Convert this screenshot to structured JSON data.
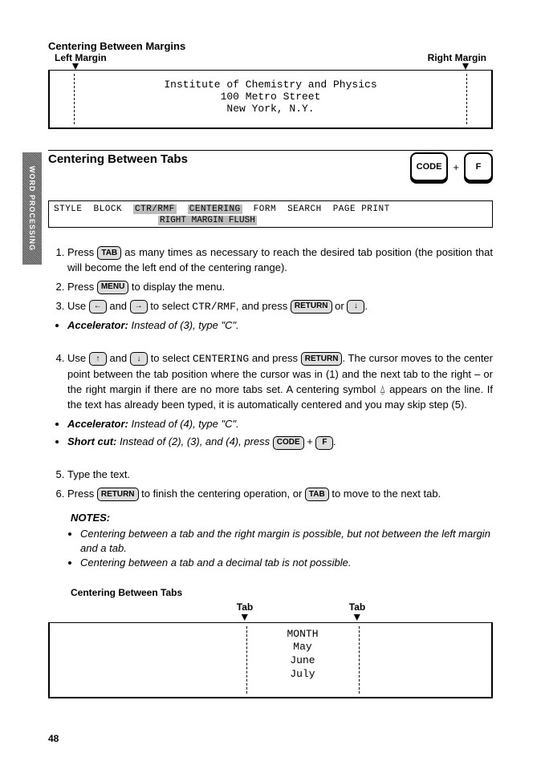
{
  "sidebar": {
    "label": "WORD PROCESSING"
  },
  "top": {
    "heading": "Centering Between Margins",
    "left_label": "Left Margin",
    "right_label": "Right Margin",
    "example": {
      "line1": "Institute of Chemistry and Physics",
      "line2": "100 Metro Street",
      "line3": "New York, N.Y."
    }
  },
  "section2": {
    "title": "Centering Between Tabs",
    "key_code": "CODE",
    "plus": "+",
    "key_f": "F"
  },
  "menu": {
    "items": [
      "STYLE",
      "BLOCK",
      "CTR/RMF",
      "CENTERING",
      "FORM",
      "SEARCH",
      "PAGE PRINT"
    ],
    "sub": "RIGHT MARGIN FLUSH"
  },
  "steps": {
    "s1a": "Press ",
    "s1_key": "TAB",
    "s1b": " as many times as necessary to reach the desired tab position (the position that will become the left end of the centering range).",
    "s2a": "Press ",
    "s2_key": "MENU",
    "s2b": " to display the menu.",
    "s3a": "Use ",
    "s3_k1": "←",
    "s3_mid": " and ",
    "s3_k2": "→",
    "s3b": " to select ",
    "s3_code": "CTR/RMF",
    "s3c": ", and press ",
    "s3_k3": "RETURN",
    "s3_or": " or ",
    "s3_k4": "↓",
    "s3d": ".",
    "acc1_label": "Accelerator:",
    "acc1_text": " Instead of (3), type \"C\".",
    "s4a": "Use ",
    "s4_k1": "↑",
    "s4_mid": " and ",
    "s4_k2": "↓",
    "s4b": " to select ",
    "s4_code": "CENTERING",
    "s4c": " and press ",
    "s4_k3": "RETURN",
    "s4d": ". The cursor moves to the center point between the tab position where the cursor was in (1) and the next tab to the right – or the right margin if there are no more tabs set. A centering symbol ",
    "s4_sym": "⍙",
    "s4e": " appears on the line. If the text has already been typed, it is automatically centered and you may skip step (5).",
    "acc2_label": "Accelerator:",
    "acc2_text": " Instead of (4), type \"C\".",
    "sc_label": "Short cut:",
    "sc_a": " Instead of (2), (3), and (4), press ",
    "sc_k1": "CODE",
    "sc_plus": " + ",
    "sc_k2": "F",
    "sc_b": ".",
    "s5": "Type the text.",
    "s6a": "Press ",
    "s6_k1": "RETURN",
    "s6b": " to finish the centering operation, or ",
    "s6_k2": "TAB",
    "s6c": " to move to the next tab."
  },
  "notes": {
    "heading": "NOTES:",
    "n1": "Centering between a tab and the right margin is possible, but not between the left margin and a tab.",
    "n2": "Centering between a tab and a decimal tab is not possible."
  },
  "bottom": {
    "heading": "Centering Between Tabs",
    "tab_label": "Tab",
    "lines": [
      "MONTH",
      "May",
      "June",
      "July"
    ]
  },
  "page_number": "48"
}
